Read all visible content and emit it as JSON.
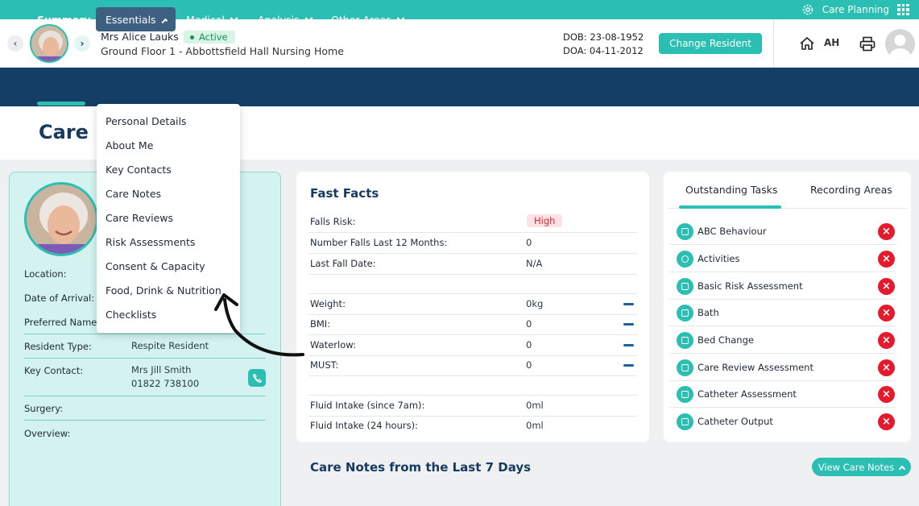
{
  "topbar": {
    "app_label": "Care Planning",
    "icons": [
      "gear-icon",
      "apps-grid-icon"
    ]
  },
  "header": {
    "resident_name": "Mrs Alice Lauks",
    "status": "Active",
    "location": "Ground Floor 1 - Abbottsfield Hall Nursing Home",
    "dob": "DOB: 23-08-1952",
    "doa": "DOA: 04-11-2012",
    "change_resident": "Change Resident",
    "user_initials": "AH"
  },
  "nav": {
    "summary": "Summary",
    "essentials": "Essentials",
    "medical": "Medical",
    "analysis": "Analysis",
    "other": "Other Areas"
  },
  "page_title": "Care S",
  "essentials_menu": [
    "Personal Details",
    "About Me",
    "Key Contacts",
    "Care Notes",
    "Care Reviews",
    "Risk Assessments",
    "Consent & Capacity",
    "Food, Drink & Nutrition",
    "Checklists"
  ],
  "profile": {
    "location_label": "Location:",
    "arrival_label": "Date of Arrival:",
    "preferred_label": "Preferred Name",
    "type_label": "Resident Type:",
    "type_value": "Respite Resident",
    "contact_label": "Key Contact:",
    "contact_name": "Mrs Jill Smith",
    "contact_phone": "01822 738100",
    "surgery_label": "Surgery:",
    "overview_label": "Overview:"
  },
  "fast_facts": {
    "title": "Fast Facts",
    "rows": [
      {
        "label": "Falls Risk:",
        "value": "High"
      },
      {
        "label": "Number Falls Last 12 Months:",
        "value": "0"
      },
      {
        "label": "Last Fall Date:",
        "value": "N/A"
      },
      {
        "label": "Weight:",
        "value": "0kg"
      },
      {
        "label": "BMI:",
        "value": "0"
      },
      {
        "label": "Waterlow:",
        "value": "0"
      },
      {
        "label": "MUST:",
        "value": "0"
      },
      {
        "label": "Fluid Intake (since 7am):",
        "value": "0ml"
      },
      {
        "label": "Fluid Intake (24 hours):",
        "value": "0ml"
      }
    ]
  },
  "tasks": {
    "tab_outstanding": "Outstanding Tasks",
    "tab_recording": "Recording Areas",
    "items": [
      "ABC Behaviour",
      "Activities",
      "Basic Risk Assessment",
      "Bath",
      "Bed Change",
      "Care Review Assessment",
      "Catheter Assessment",
      "Catheter Output"
    ]
  },
  "care_notes": {
    "title": "Care Notes from the Last 7 Days",
    "view_button": "View Care Notes"
  }
}
